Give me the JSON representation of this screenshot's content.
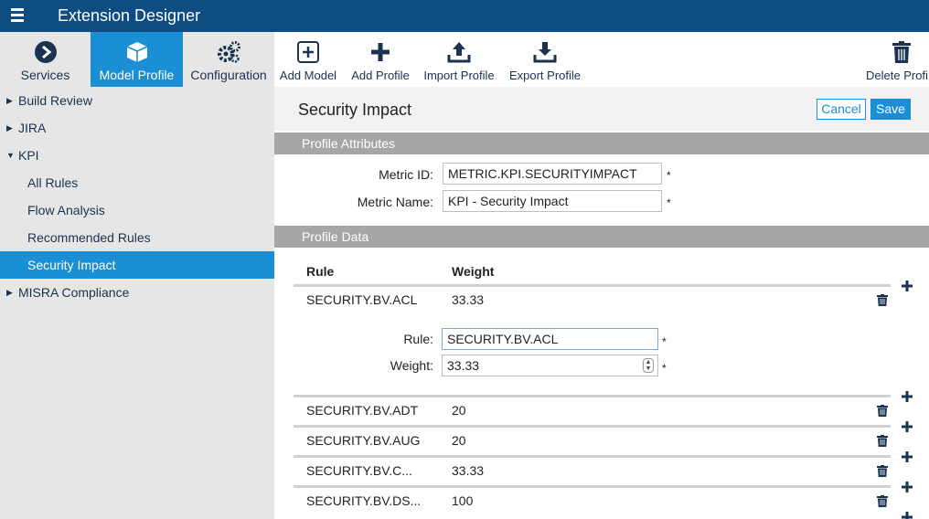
{
  "app": {
    "title": "Extension Designer"
  },
  "nav_tabs": [
    {
      "label": "Services",
      "icon": "circle-arrow-icon"
    },
    {
      "label": "Model Profile",
      "icon": "cube-icon"
    },
    {
      "label": "Configuration",
      "icon": "gears-icon"
    }
  ],
  "toolbar": {
    "add_model": "Add Model",
    "add_profile": "Add Profile",
    "import_profile": "Import Profile",
    "export_profile": "Export Profile",
    "delete_profile": "Delete Profi"
  },
  "sidebar": {
    "items": [
      {
        "label": "Build Review",
        "caret": "▶"
      },
      {
        "label": "JIRA",
        "caret": "▶"
      },
      {
        "label": "KPI",
        "caret": "▼"
      },
      {
        "label": "All Rules"
      },
      {
        "label": "Flow Analysis"
      },
      {
        "label": "Recommended Rules"
      },
      {
        "label": "Security Impact"
      },
      {
        "label": "MISRA Compliance",
        "caret": "▶"
      }
    ]
  },
  "page": {
    "title": "Security Impact",
    "cancel": "Cancel",
    "save": "Save"
  },
  "profile_attributes": {
    "header": "Profile Attributes",
    "metric_id_label": "Metric ID:",
    "metric_id_value": "METRIC.KPI.SECURITYIMPACT",
    "metric_name_label": "Metric Name:",
    "metric_name_value": "KPI - Security Impact",
    "required": "*"
  },
  "profile_data": {
    "header": "Profile Data",
    "col_rule": "Rule",
    "col_weight": "Weight",
    "rows": [
      {
        "rule": "SECURITY.BV.ACL",
        "weight": "33.33"
      },
      {
        "rule": "SECURITY.BV.ADT",
        "weight": "20"
      },
      {
        "rule": "SECURITY.BV.AUG",
        "weight": "20"
      },
      {
        "rule": "SECURITY.BV.C...",
        "weight": "33.33"
      },
      {
        "rule": "SECURITY.BV.DS...",
        "weight": "100"
      }
    ],
    "editor": {
      "rule_label": "Rule:",
      "rule_value": "SECURITY.BV.ACL",
      "weight_label": "Weight:",
      "weight_value": "33.33"
    }
  },
  "colors": {
    "header": "#0f4c81",
    "accent": "#1a8fd6",
    "section": "#a6a6a6"
  }
}
